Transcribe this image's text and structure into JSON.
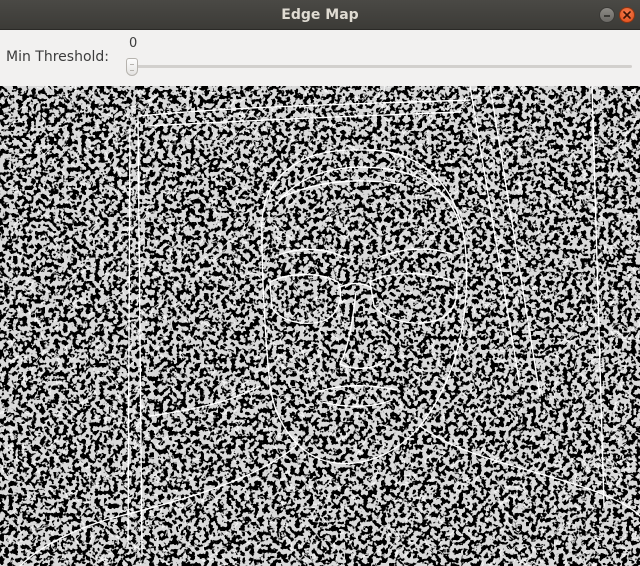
{
  "window": {
    "title": "Edge Map"
  },
  "controls": {
    "threshold_label": "Min Threshold:",
    "threshold_value": "0",
    "threshold_fraction": 0
  },
  "icons": {
    "minimize": "minimize-icon",
    "close": "close-icon"
  },
  "colors": {
    "titlebar": "#3c3b37",
    "close_button": "#e95420",
    "edge_color": "#ffffff",
    "background": "#000000"
  }
}
